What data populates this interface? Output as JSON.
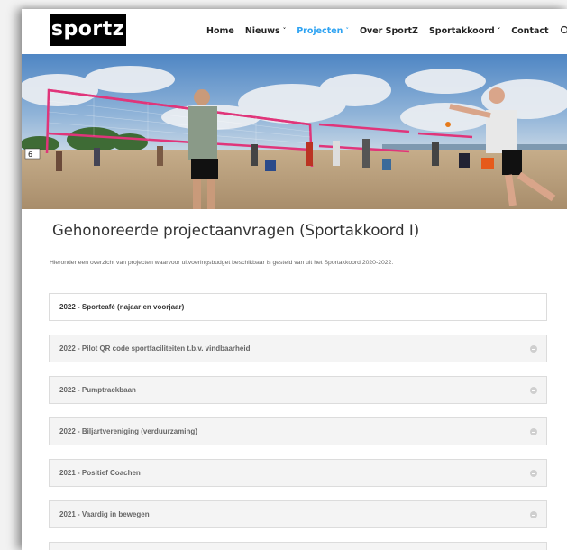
{
  "logo": "sportz",
  "nav": [
    {
      "label": "Home",
      "dropdown": false,
      "active": false
    },
    {
      "label": "Nieuws",
      "dropdown": true,
      "active": false
    },
    {
      "label": "Projecten",
      "dropdown": true,
      "active": true
    },
    {
      "label": "Over SportZ",
      "dropdown": false,
      "active": false
    },
    {
      "label": "Sportakkoord",
      "dropdown": true,
      "active": false
    },
    {
      "label": "Contact",
      "dropdown": false,
      "active": false
    }
  ],
  "colors": {
    "accent": "#2ea3f2",
    "logo_bg": "#000000"
  },
  "page": {
    "title": "Gehonoreerde projectaanvragen (Sportakkoord I)",
    "intro": "Hieronder een overzicht van projecten waarvoor uitvoeringsbudget beschikbaar is gesteld van uit het Sportakkoord 2020-2022."
  },
  "accordion": [
    {
      "title": "2022 - Sportcafé (najaar en voorjaar)",
      "open": true
    },
    {
      "title": "2022 - Pilot QR code sportfaciliteiten t.b.v. vindbaarheid",
      "open": false
    },
    {
      "title": "2022 - Pumptrackbaan",
      "open": false
    },
    {
      "title": "2022 - Biljartvereniging (verduurzaming)",
      "open": false
    },
    {
      "title": "2021 - Positief Coachen",
      "open": false
    },
    {
      "title": "2021 - Vaardig in bewegen",
      "open": false
    },
    {
      "title": "",
      "open": false
    }
  ]
}
